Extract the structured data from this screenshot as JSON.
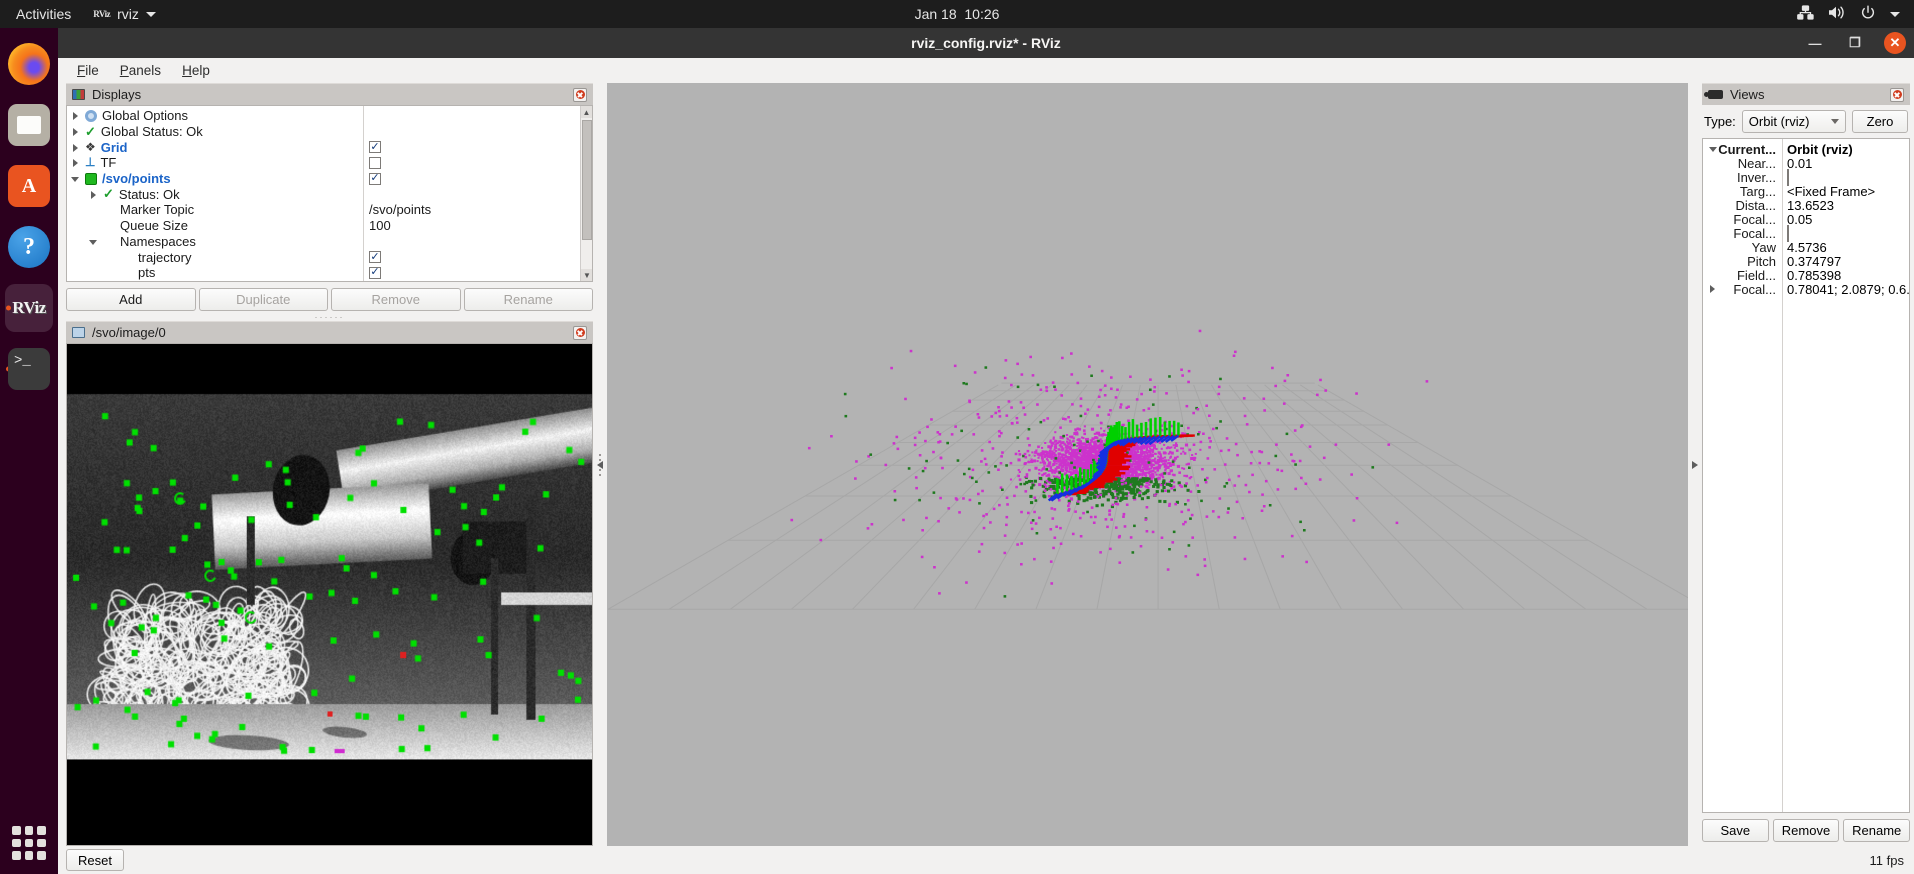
{
  "desktop": {
    "activities": "Activities",
    "app_name": "rviz",
    "app_icon": "RViz",
    "clock": "Jan 18  10:26",
    "tray_icons": [
      "network-icon",
      "volume-icon",
      "power-icon",
      "chevron-down-icon"
    ],
    "dock": [
      {
        "name": "firefox",
        "label": "Firefox",
        "running": false,
        "active": false
      },
      {
        "name": "files",
        "label": "Files",
        "running": false,
        "active": false
      },
      {
        "name": "software",
        "label": "Ubuntu Software",
        "running": false,
        "active": false
      },
      {
        "name": "help",
        "label": "Help",
        "running": false,
        "active": false
      },
      {
        "name": "rviz",
        "label": "RViz",
        "running": true,
        "active": true
      },
      {
        "name": "terminal",
        "label": "Terminal",
        "running": true,
        "active": false
      }
    ],
    "show_apps": "Show Applications"
  },
  "window": {
    "title": "rviz_config.rviz* - RViz",
    "minimize": "—",
    "maximize": "❐",
    "close": "✕"
  },
  "menubar": [
    {
      "label": "File",
      "mnemonic": "F"
    },
    {
      "label": "Panels",
      "mnemonic": "P"
    },
    {
      "label": "Help",
      "mnemonic": "H"
    }
  ],
  "displays_panel": {
    "title": "Displays",
    "icon": "monitor-icon",
    "tree": [
      {
        "indent": 0,
        "arrow": "collapsed",
        "icon": "gear-icon",
        "label": "Global Options",
        "style": "normal",
        "value_type": "none"
      },
      {
        "indent": 0,
        "arrow": "collapsed",
        "icon": "check-icon",
        "label": "Global Status: Ok",
        "style": "normal",
        "value_type": "none"
      },
      {
        "indent": 0,
        "arrow": "collapsed",
        "icon": "grid-icon",
        "label": "Grid",
        "style": "link",
        "value_type": "checkbox",
        "checked": true
      },
      {
        "indent": 0,
        "arrow": "collapsed",
        "icon": "axes-icon",
        "label": "TF",
        "style": "normal",
        "value_type": "checkbox",
        "checked": false
      },
      {
        "indent": 0,
        "arrow": "expanded",
        "icon": "marker-icon",
        "label": "/svo/points",
        "style": "link",
        "value_type": "checkbox",
        "checked": true
      },
      {
        "indent": 1,
        "arrow": "collapsed",
        "icon": "check-icon",
        "label": "Status: Ok",
        "style": "normal",
        "value_type": "none"
      },
      {
        "indent": 1,
        "arrow": "none",
        "icon": "none",
        "label": "Marker Topic",
        "style": "normal",
        "value_type": "text",
        "value": "/svo/points"
      },
      {
        "indent": 1,
        "arrow": "none",
        "icon": "none",
        "label": "Queue Size",
        "style": "normal",
        "value_type": "text",
        "value": "100"
      },
      {
        "indent": 1,
        "arrow": "expanded",
        "icon": "none",
        "label": "Namespaces",
        "style": "normal",
        "value_type": "none"
      },
      {
        "indent": 2,
        "arrow": "none",
        "icon": "none",
        "label": "trajectory",
        "style": "normal",
        "value_type": "checkbox",
        "checked": true
      },
      {
        "indent": 2,
        "arrow": "none",
        "icon": "none",
        "label": "pts",
        "style": "normal",
        "value_type": "checkbox",
        "checked": true
      }
    ],
    "buttons": [
      {
        "label": "Add",
        "enabled": true
      },
      {
        "label": "Duplicate",
        "enabled": false
      },
      {
        "label": "Remove",
        "enabled": false
      },
      {
        "label": "Rename",
        "enabled": false
      }
    ]
  },
  "image_panel": {
    "title": "/svo/image/0",
    "icon": "image-icon"
  },
  "views_panel": {
    "title": "Views",
    "icon": "camera-icon",
    "type_label": "Type:",
    "type_value": "Orbit (rviz)",
    "zero_button": "Zero",
    "properties": [
      {
        "key": "Current...",
        "value": "Orbit (rviz)",
        "arrow": "expanded",
        "bold": true,
        "type": "text"
      },
      {
        "key": "Near...",
        "value": "0.01",
        "arrow": "none",
        "bold": false,
        "type": "text"
      },
      {
        "key": "Inver...",
        "value": "",
        "arrow": "none",
        "bold": false,
        "type": "checkbox",
        "checked": false
      },
      {
        "key": "Targ...",
        "value": "<Fixed Frame>",
        "arrow": "none",
        "bold": false,
        "type": "text"
      },
      {
        "key": "Dista...",
        "value": "13.6523",
        "arrow": "none",
        "bold": false,
        "type": "text"
      },
      {
        "key": "Focal...",
        "value": "0.05",
        "arrow": "none",
        "bold": false,
        "type": "text"
      },
      {
        "key": "Focal...",
        "value": "",
        "arrow": "none",
        "bold": false,
        "type": "checkbox",
        "checked": false
      },
      {
        "key": "Yaw",
        "value": "4.5736",
        "arrow": "none",
        "bold": false,
        "type": "text"
      },
      {
        "key": "Pitch",
        "value": "0.374797",
        "arrow": "none",
        "bold": false,
        "type": "text"
      },
      {
        "key": "Field...",
        "value": "0.785398",
        "arrow": "none",
        "bold": false,
        "type": "text"
      },
      {
        "key": "Focal...",
        "value": "0.78041; 2.0879; 0.6...",
        "arrow": "collapsed",
        "bold": false,
        "type": "text"
      }
    ],
    "buttons": [
      {
        "label": "Save"
      },
      {
        "label": "Remove"
      },
      {
        "label": "Rename"
      }
    ]
  },
  "statusbar": {
    "reset_button": "Reset",
    "fps": "11 fps"
  },
  "colors": {
    "accent_orange": "#e95420",
    "link_blue": "#1b64c8",
    "status_green": "#1e9e2e",
    "panel_bg": "#f2f1f0",
    "header_bg": "#c9c6c3",
    "viewport_bg": "#b3b3b3",
    "point_magenta": "#cc33cc",
    "point_green": "#1f7a1f",
    "feature_green": "#00e000"
  }
}
